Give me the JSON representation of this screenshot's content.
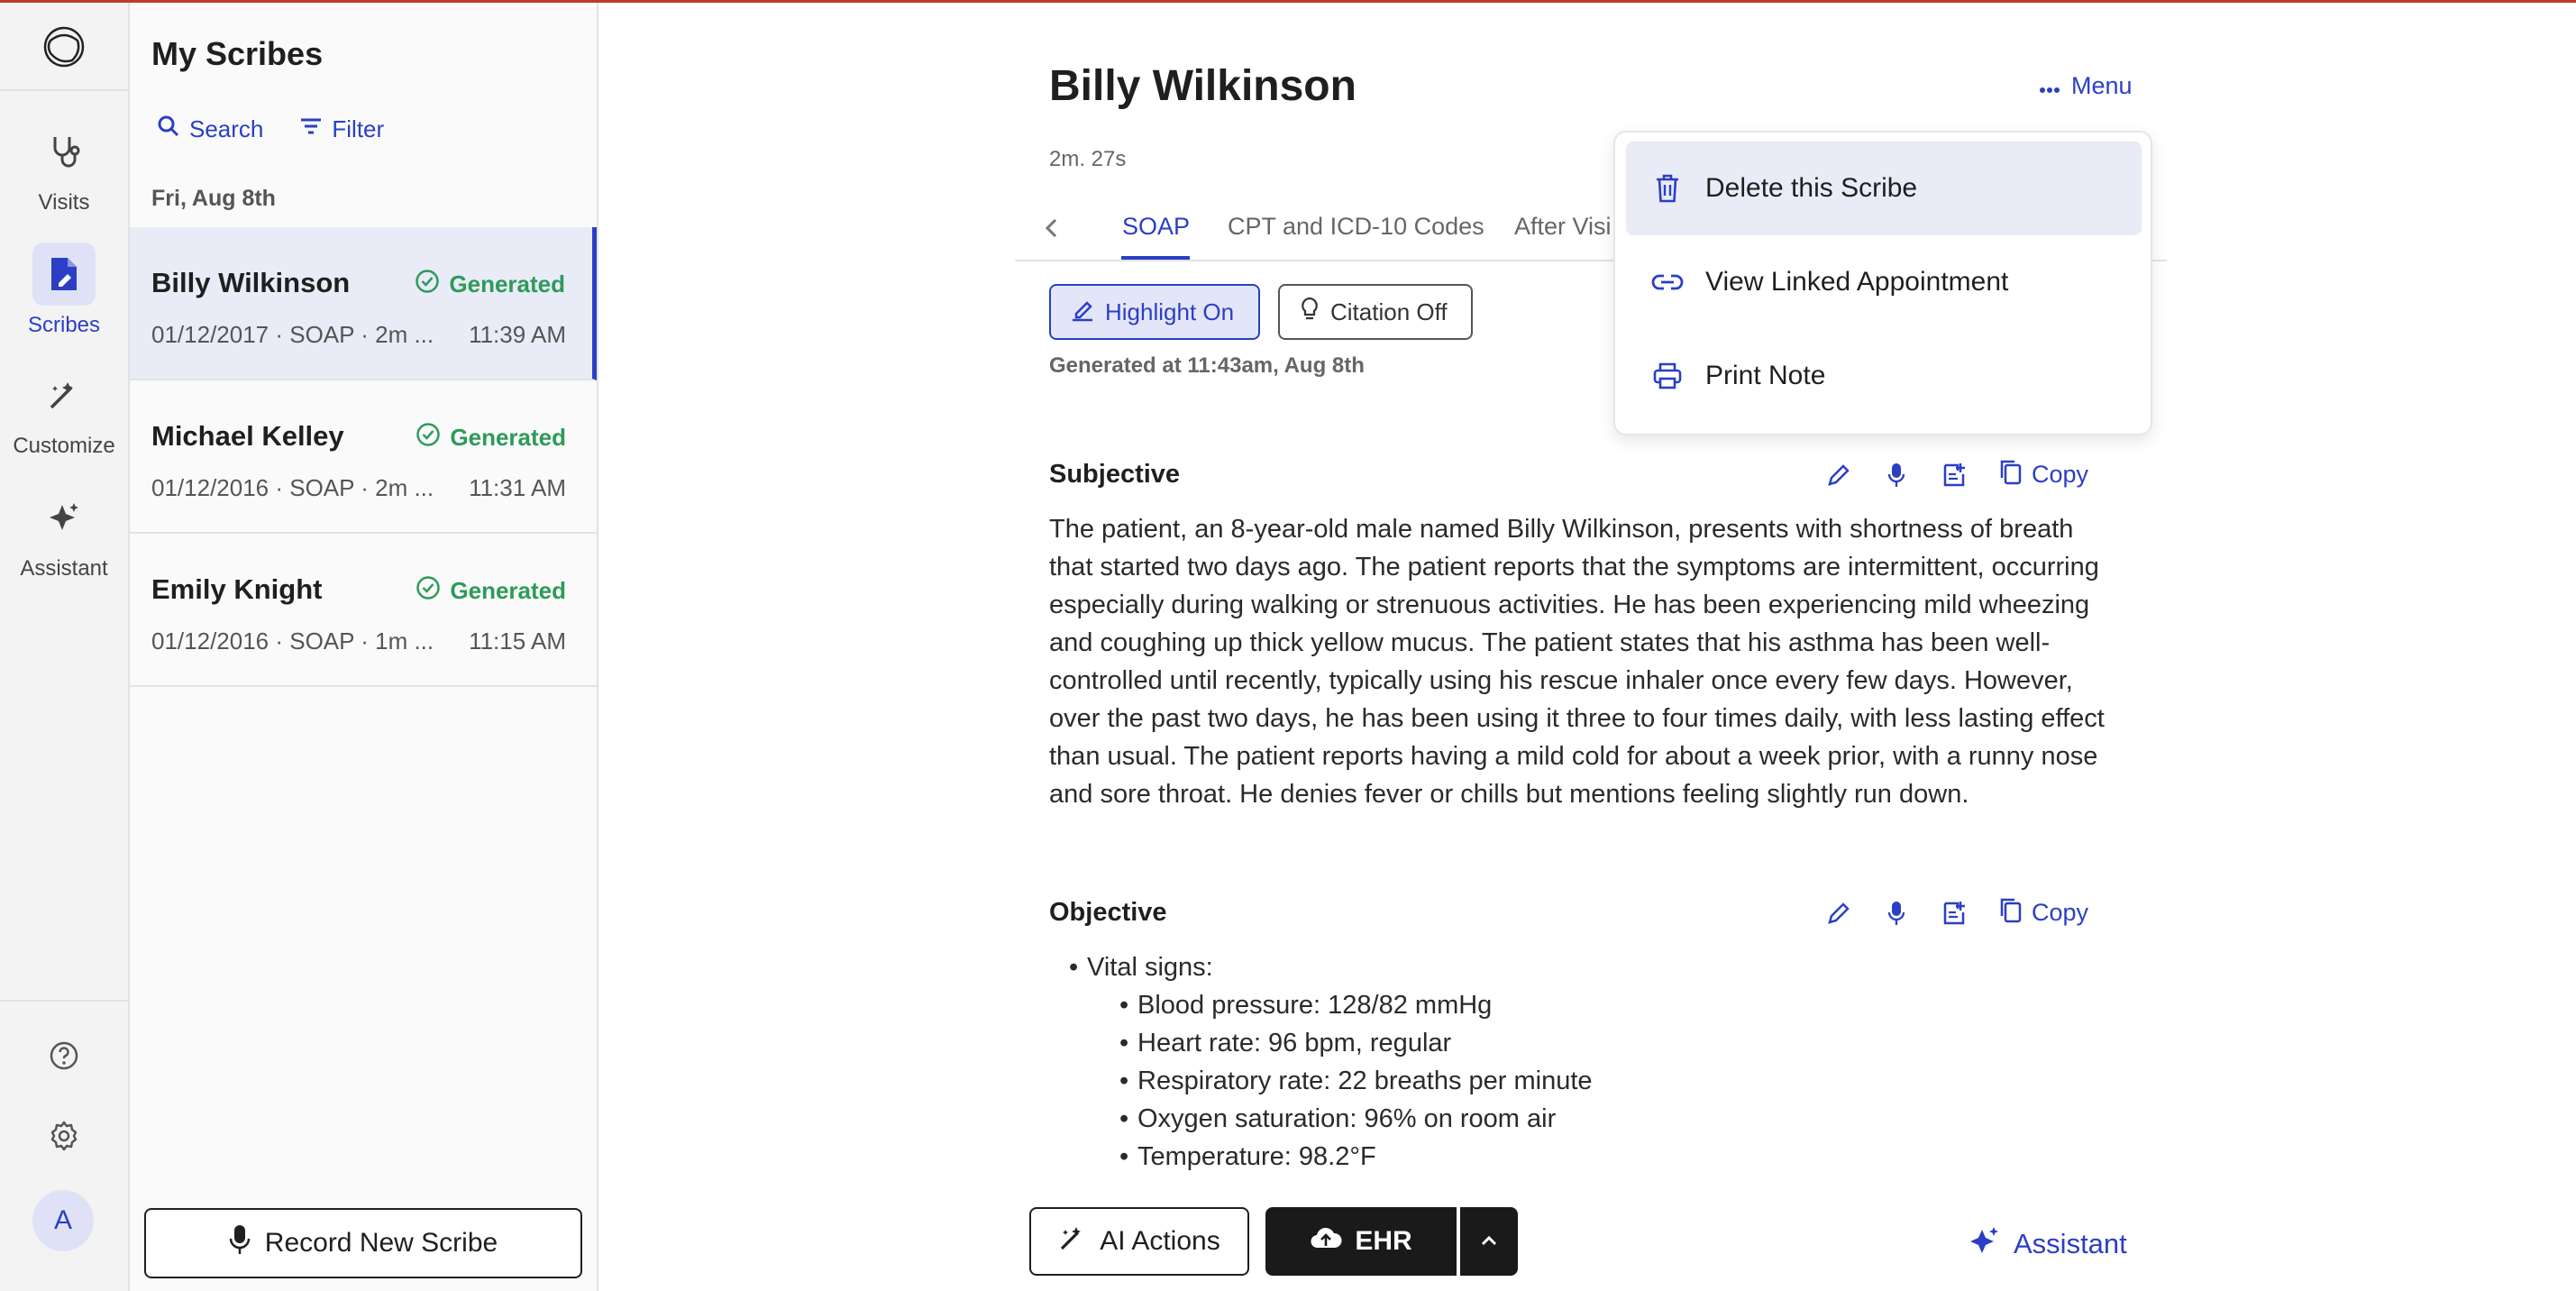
{
  "colors": {
    "accent": "#2b3fc4",
    "success": "#2e9a5a",
    "dark_button": "#1a1a1a",
    "active_bg": "#e9ebf7"
  },
  "rail": {
    "logo_icon": "app-logo-icon",
    "items": [
      {
        "label": "Visits",
        "icon": "stethoscope-icon"
      },
      {
        "label": "Scribes",
        "icon": "scribe-doc-icon"
      },
      {
        "label": "Customize",
        "icon": "magic-wand-icon"
      },
      {
        "label": "Assistant",
        "icon": "sparkle-icon"
      }
    ],
    "help_icon": "help-icon",
    "settings_icon": "gear-icon",
    "avatar_initial": "A"
  },
  "list": {
    "title": "My Scribes",
    "search_label": "Search",
    "filter_label": "Filter",
    "date_header": "Fri, Aug 8th",
    "items": [
      {
        "name": "Billy Wilkinson",
        "status": "Generated",
        "meta": "01/12/2017 · SOAP · 2m ...",
        "time": "11:39 AM"
      },
      {
        "name": "Michael Kelley",
        "status": "Generated",
        "meta": "01/12/2016 · SOAP · 2m ...",
        "time": "11:31 AM"
      },
      {
        "name": "Emily Knight",
        "status": "Generated",
        "meta": "01/12/2016 · SOAP · 1m ...",
        "time": "11:15 AM"
      }
    ],
    "record_button": "Record New Scribe"
  },
  "main": {
    "patient_name": "Billy Wilkinson",
    "menu_label": "Menu",
    "duration": "2m. 27s",
    "tabs": [
      "SOAP",
      "CPT and ICD-10 Codes",
      "After Visi"
    ],
    "highlight_label": "Highlight On",
    "citation_label": "Citation Off",
    "generated_at": "Generated at 11:43am, Aug 8th",
    "copy_label": "Copy",
    "subjective": {
      "title": "Subjective",
      "text": "The patient, an 8-year-old male named Billy Wilkinson, presents with shortness of breath that started two days ago. The patient reports that the symptoms are intermittent, occurring especially during walking or strenuous activities. He has been experiencing mild wheezing and coughing up thick yellow mucus. The patient states that his asthma has been well-controlled until recently, typically using his rescue inhaler once every few days. However, over the past two days, he has been using it three to four times daily, with less lasting effect than usual. The patient reports having a mild cold for about a week prior, with a runny nose and sore throat. He denies fever or chills but mentions feeling slightly run down."
    },
    "objective": {
      "title": "Objective",
      "vitals_header": "Vital signs:",
      "vitals": [
        "Blood pressure: 128/82 mmHg",
        "Heart rate: 96 bpm, regular",
        "Respiratory rate: 22 breaths per minute",
        "Oxygen saturation: 96% on room air",
        "Temperature: 98.2°F"
      ]
    }
  },
  "bottom": {
    "ai_actions": "AI Actions",
    "ehr": "EHR",
    "assistant": "Assistant"
  },
  "dropdown": {
    "items": [
      {
        "label": "Delete this Scribe",
        "icon": "trash-icon"
      },
      {
        "label": "View Linked Appointment",
        "icon": "link-icon"
      },
      {
        "label": "Print Note",
        "icon": "printer-icon"
      }
    ]
  }
}
